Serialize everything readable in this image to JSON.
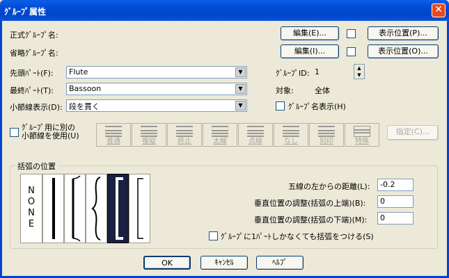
{
  "window": {
    "title": "ｸﾞﾙｰﾌﾟ属性",
    "close_glyph": "✕"
  },
  "names": {
    "formal_label": "正式ｸﾞﾙｰﾌﾟ名:",
    "short_label": "省略ｸﾞﾙｰﾌﾟ名:",
    "edit_label_1": "編集(E)...",
    "edit_label_2": "編集(I)...",
    "display_pos_1": "表示位置(P)...",
    "display_pos_2": "表示位置(O)..."
  },
  "parts": {
    "first_label": "先頭ﾊﾟｰﾄ(F):",
    "first_value": "Flute",
    "last_label": "最終ﾊﾟｰﾄ(T):",
    "last_value": "Bassoon",
    "barline_label": "小節線表示(D):",
    "barline_value": "段を貫く"
  },
  "group_id": {
    "label": "ｸﾞﾙｰﾌﾟID:",
    "value": "1"
  },
  "target": {
    "label": "対象:",
    "value": "全体"
  },
  "show_group_name": "ｸﾞﾙｰﾌﾟ名表示(H)",
  "separate_barline": {
    "line1": "ｸﾞﾙｰﾌﾟ用に別の",
    "line2": "小節線を使用(U)"
  },
  "barline_styles": [
    "普通",
    "複縦",
    "終止",
    "太線",
    "点線",
    "なし",
    "刻印",
    "特殊"
  ],
  "specify_button": "指定(C)...",
  "bracket": {
    "legend": "括弧の位置",
    "none_label": [
      "N",
      "O",
      "N",
      "E"
    ],
    "distance_label": "五線の左からの距離(L):",
    "distance_value": "-0.2",
    "vert_top_label": "垂直位置の調整(括弧の上端)(B):",
    "vert_top_value": "0",
    "vert_bottom_label": "垂直位置の調整(括弧の下端)(M):",
    "vert_bottom_value": "0",
    "single_part_label": "ｸﾞﾙｰﾌﾟに1ﾊﾟｰﾄしかなくても括弧をつける(S)"
  },
  "footer": {
    "ok": "OK",
    "cancel": "ｷｬﾝｾﾙ",
    "help": "ﾍﾙﾌﾟ"
  }
}
